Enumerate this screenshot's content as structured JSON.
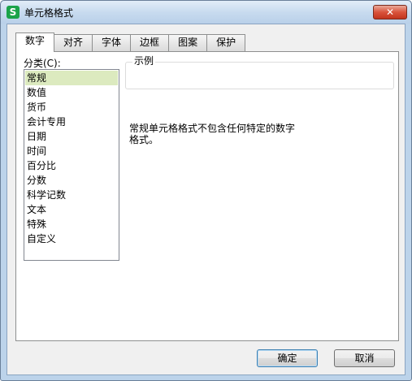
{
  "window": {
    "title": "单元格格式",
    "app_icon_glyph": "S",
    "close_glyph": "✕"
  },
  "tabs": [
    {
      "label": "数字",
      "active": true
    },
    {
      "label": "对齐",
      "active": false
    },
    {
      "label": "字体",
      "active": false
    },
    {
      "label": "边框",
      "active": false
    },
    {
      "label": "图案",
      "active": false
    },
    {
      "label": "保护",
      "active": false
    }
  ],
  "category": {
    "label": "分类(C):",
    "items": [
      "常规",
      "数值",
      "货币",
      "会计专用",
      "日期",
      "时间",
      "百分比",
      "分数",
      "科学记数",
      "文本",
      "特殊",
      "自定义"
    ],
    "selected_index": 0
  },
  "sample": {
    "legend": "示例",
    "value": ""
  },
  "description": "常规单元格格式不包含任何特定的数字\n格式。",
  "buttons": {
    "ok": "确定",
    "cancel": "取消"
  },
  "colors": {
    "selected_item_bg": "#dceabf",
    "app_icon": "#1aa34a",
    "close_button": "#d9533b"
  }
}
